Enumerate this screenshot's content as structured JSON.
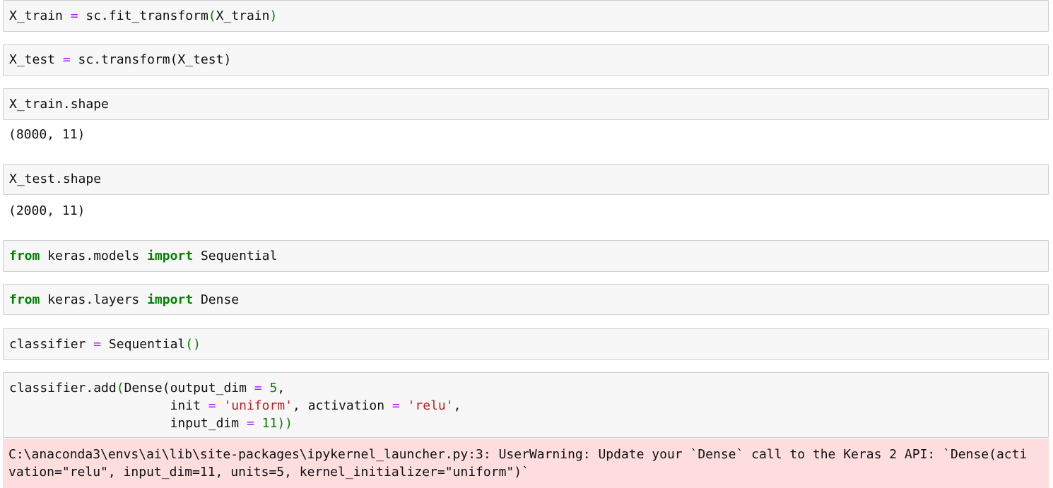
{
  "cells": [
    {
      "id": "cell-1",
      "lines": [
        [
          {
            "t": "X_train ",
            "c": ""
          },
          {
            "t": "=",
            "c": "op"
          },
          {
            "t": " sc.fit_transform",
            "c": ""
          },
          {
            "t": "(",
            "c": "paren"
          },
          {
            "t": "X_train",
            "c": ""
          },
          {
            "t": ")",
            "c": "paren"
          }
        ]
      ]
    },
    {
      "id": "cell-2",
      "lines": [
        [
          {
            "t": "X_test ",
            "c": ""
          },
          {
            "t": "=",
            "c": "op"
          },
          {
            "t": " sc.transform(X_test)",
            "c": ""
          }
        ]
      ]
    },
    {
      "id": "cell-3",
      "lines": [
        [
          {
            "t": "X_train.shape",
            "c": ""
          }
        ]
      ],
      "output": "(8000, 11)"
    },
    {
      "id": "cell-4",
      "lines": [
        [
          {
            "t": "X_test.shape",
            "c": ""
          }
        ]
      ],
      "output": "(2000, 11)"
    },
    {
      "id": "cell-5",
      "lines": [
        [
          {
            "t": "from",
            "c": "kw"
          },
          {
            "t": " keras.models ",
            "c": ""
          },
          {
            "t": "import",
            "c": "kw"
          },
          {
            "t": " Sequential",
            "c": ""
          }
        ]
      ]
    },
    {
      "id": "cell-6",
      "lines": [
        [
          {
            "t": "from",
            "c": "kw"
          },
          {
            "t": " keras.layers ",
            "c": ""
          },
          {
            "t": "import",
            "c": "kw"
          },
          {
            "t": " Dense",
            "c": ""
          }
        ]
      ]
    },
    {
      "id": "cell-7",
      "lines": [
        [
          {
            "t": "classifier ",
            "c": ""
          },
          {
            "t": "=",
            "c": "op"
          },
          {
            "t": " Sequential",
            "c": ""
          },
          {
            "t": "()",
            "c": "paren"
          }
        ]
      ]
    },
    {
      "id": "cell-8",
      "lines": [
        [
          {
            "t": "classifier.add",
            "c": ""
          },
          {
            "t": "(",
            "c": "paren"
          },
          {
            "t": "Dense(output_dim ",
            "c": ""
          },
          {
            "t": "=",
            "c": "op"
          },
          {
            "t": " ",
            "c": ""
          },
          {
            "t": "5",
            "c": "num"
          },
          {
            "t": ",",
            "c": ""
          }
        ],
        [
          {
            "t": "                     init ",
            "c": ""
          },
          {
            "t": "=",
            "c": "op"
          },
          {
            "t": " ",
            "c": ""
          },
          {
            "t": "'uniform'",
            "c": "str"
          },
          {
            "t": ", activation ",
            "c": ""
          },
          {
            "t": "=",
            "c": "op"
          },
          {
            "t": " ",
            "c": ""
          },
          {
            "t": "'relu'",
            "c": "str"
          },
          {
            "t": ",",
            "c": ""
          }
        ],
        [
          {
            "t": "                     input_dim ",
            "c": ""
          },
          {
            "t": "=",
            "c": "op"
          },
          {
            "t": " ",
            "c": ""
          },
          {
            "t": "11",
            "c": "num"
          },
          {
            "t": "))",
            "c": "paren"
          }
        ]
      ],
      "stderr": [
        "C:\\anaconda3\\envs\\ai\\lib\\site-packages\\ipykernel_launcher.py:3: UserWarning: Update your `Dense` call to the Keras 2 API: `Dense(acti",
        "vation=\"relu\", input_dim=11, units=5, kernel_initializer=\"uniform\")`"
      ]
    }
  ]
}
